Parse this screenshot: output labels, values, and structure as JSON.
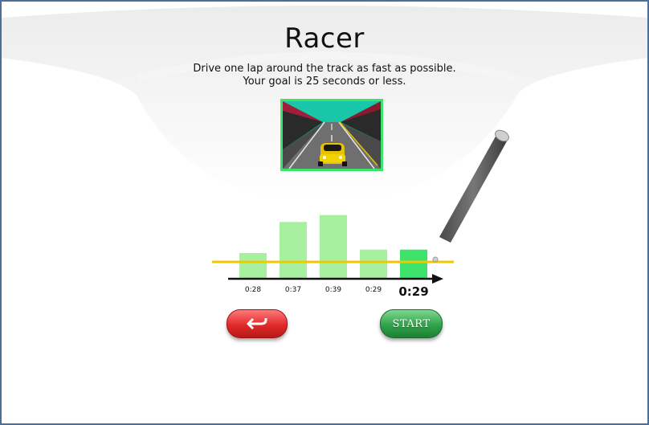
{
  "game": {
    "title": "Racer",
    "instruction_line1": "Drive one lap around the track as fast as possible.",
    "instruction_line2": "Your goal is 25 seconds or less."
  },
  "buttons": {
    "start_label": "START",
    "back_icon": "back-arrow-icon"
  },
  "colors": {
    "accent_green": "#3ee36b",
    "goal_line": "#f0c800",
    "bar_green": "#a6f0a0",
    "current_bar": "#3ee36b",
    "back_red": "#e02a2a",
    "start_green": "#2fa34a"
  },
  "chart_data": {
    "type": "bar",
    "categories": [
      "0:28",
      "0:37",
      "0:39",
      "0:29",
      "0:29"
    ],
    "values": [
      28,
      37,
      39,
      29,
      29
    ],
    "goal_value": 25,
    "highlight_last": true,
    "title": "",
    "xlabel": "",
    "ylabel": ""
  }
}
